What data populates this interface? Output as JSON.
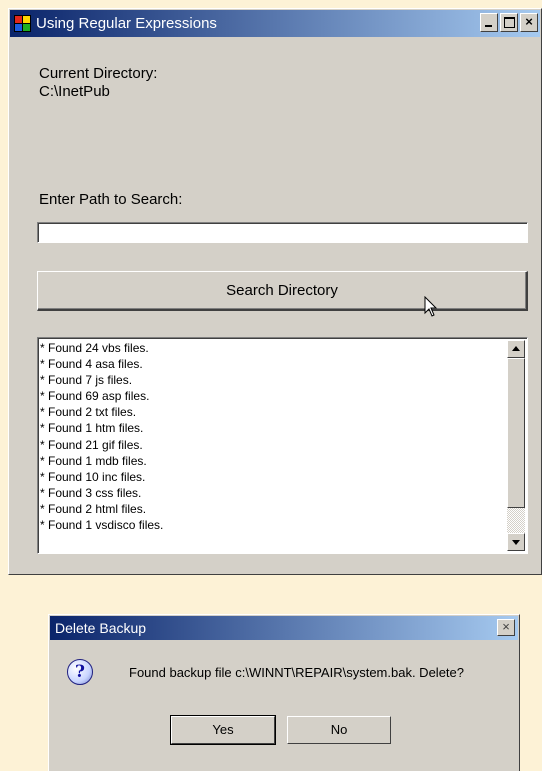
{
  "main_window": {
    "title": "Using Regular Expressions",
    "title_buttons": {
      "minimize": "_",
      "maximize": "□",
      "close": "×"
    },
    "current_directory_label": "Current Directory:",
    "current_directory_value": "C:\\InetPub",
    "path_label": "Enter Path to Search:",
    "path_input": {
      "value": "",
      "placeholder": ""
    },
    "search_button_label": "Search Directory",
    "results": [
      "* Found 24 vbs files.",
      "* Found 4 asa files.",
      "* Found 7 js files.",
      "* Found 69 asp files.",
      "* Found 2 txt files.",
      "* Found 1 htm files.",
      "* Found 21 gif files.",
      "* Found 1 mdb files.",
      "* Found 10 inc files.",
      "* Found 3 css files.",
      "* Found 2 html files.",
      "* Found 1 vsdisco files."
    ]
  },
  "dialog": {
    "title": "Delete Backup",
    "close": "×",
    "icon": "question-icon",
    "icon_glyph": "?",
    "message": "Found backup file c:\\WINNT\\REPAIR\\system.bak. Delete?",
    "yes_label": "Yes",
    "no_label": "No"
  },
  "colors": {
    "titlebar_start": "#0a246a",
    "titlebar_end": "#a6caf0",
    "face": "#d4d0c8",
    "background": "#fdf2d6"
  }
}
